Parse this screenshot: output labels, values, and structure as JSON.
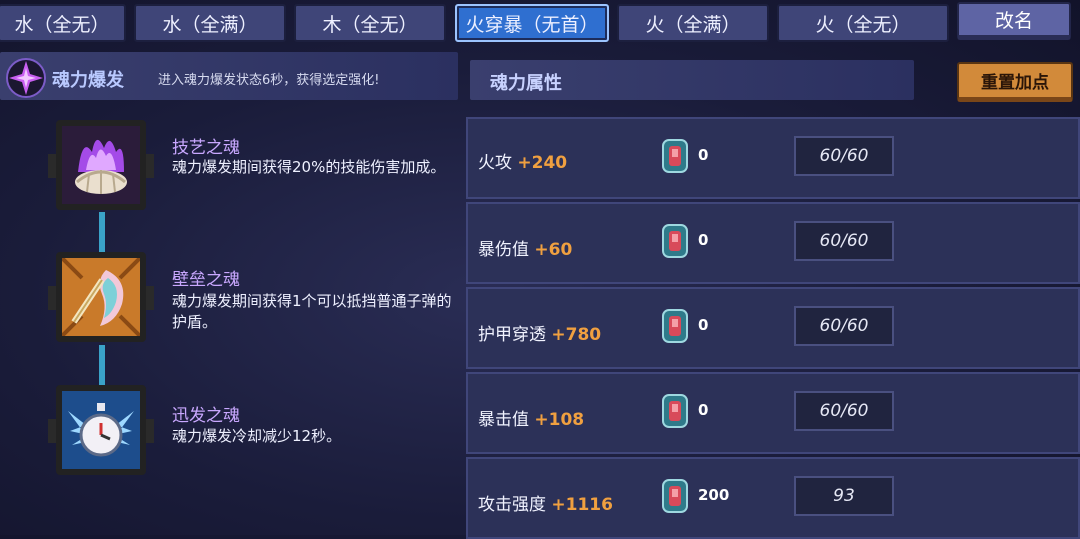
{
  "tabs": [
    {
      "label": "水（全无）"
    },
    {
      "label": "水（全满）"
    },
    {
      "label": "木（全无）"
    },
    {
      "label": "火穿暴（无首）"
    },
    {
      "label": "火（全满）"
    },
    {
      "label": "火（全无）"
    }
  ],
  "rename_button": "改名",
  "burst": {
    "title": "魂力爆发",
    "desc": "进入魂力爆发状态6秒，获得选定强化!"
  },
  "skills": [
    {
      "name": "技艺之魂",
      "desc": "魂力爆发期间获得20%的技能伤害加成。",
      "icon": "purple-flame-shell-icon"
    },
    {
      "name": "壁垒之魂",
      "desc": "魂力爆发期间获得1个可以抵挡普通子弹的护盾。",
      "icon": "shield-icon"
    },
    {
      "name": "迅发之魂",
      "desc": "魂力爆发冷却减少12秒。",
      "icon": "winged-stopwatch-icon"
    }
  ],
  "attributes": {
    "title": "魂力属性",
    "reset_button": "重置加点",
    "rows": [
      {
        "name": "火攻",
        "bonus": "+240",
        "gems": "0",
        "value": "60/60"
      },
      {
        "name": "暴伤值",
        "bonus": "+60",
        "gems": "0",
        "value": "60/60"
      },
      {
        "name": "护甲穿透",
        "bonus": "+780",
        "gems": "0",
        "value": "60/60"
      },
      {
        "name": "暴击值",
        "bonus": "+108",
        "gems": "0",
        "value": "60/60"
      },
      {
        "name": "攻击强度",
        "bonus": "+1116",
        "gems": "200",
        "value": "93"
      }
    ]
  },
  "colors": {
    "active_tab": "#2f6fd0",
    "bonus": "#f0a040",
    "reset_button": "#d28a3a"
  }
}
